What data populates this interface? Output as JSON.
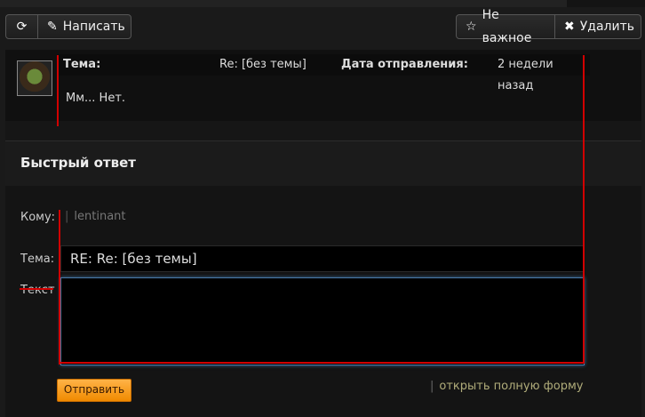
{
  "toolbar": {
    "refresh_icon": "refresh-icon",
    "compose_icon": "pencil-icon",
    "compose_label": "Написать",
    "not_important_icon": "star-outline-icon",
    "not_important_label": "Не важное",
    "delete_icon": "close-icon",
    "delete_label": "Удалить"
  },
  "message": {
    "subject_label": "Тема:",
    "subject_value": "Re: [без темы]",
    "date_label": "Дата отправления:",
    "date_value": "2 недели назад",
    "body": "Мм... Нет."
  },
  "reply": {
    "title": "Быстрый ответ",
    "to_label": "Кому:",
    "to_value": "lentinant",
    "subject_label": "Тема:",
    "subject_value": "RE: Re: [без темы]",
    "text_label": "Текст",
    "send_label": "Отправить",
    "full_form_label": "открыть полную форму"
  },
  "colors": {
    "accent_orange": "#f08a00",
    "annotation_red": "#d10000",
    "link_olive": "#b0ac7a"
  }
}
